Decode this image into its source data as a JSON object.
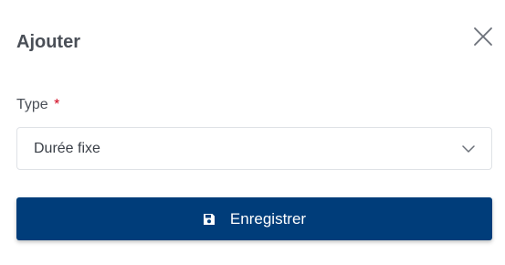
{
  "dialog": {
    "title": "Ajouter",
    "close_icon": "close-icon"
  },
  "form": {
    "type_field": {
      "label": "Type",
      "required_marker": "*",
      "selected_value": "Durée fixe",
      "chevron_icon": "chevron-down-icon"
    },
    "save_button": {
      "label": "Enregistrer",
      "icon": "save-icon"
    }
  },
  "colors": {
    "primary": "#003d7a",
    "required": "#d0021b",
    "border": "#dfe2e6",
    "text": "#3a3f47"
  }
}
